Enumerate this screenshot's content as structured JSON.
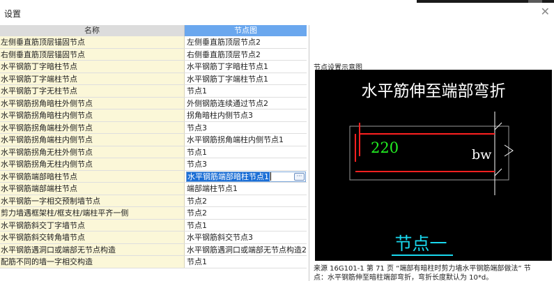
{
  "dialog": {
    "title": "设置",
    "close_icon": "close-icon"
  },
  "table": {
    "headers": [
      "名称",
      "节点图"
    ],
    "rows": [
      [
        "左侧垂直筋顶层锚固节点",
        "左侧垂直筋顶层节点2"
      ],
      [
        "右侧垂直筋顶层锚固节点",
        "右侧垂直筋顶层节点2"
      ],
      [
        "水平钢筋丁字暗柱节点",
        "水平钢筋丁字暗柱节点1"
      ],
      [
        "水平钢筋丁字端柱节点",
        "水平钢筋丁字端柱节点1"
      ],
      [
        "水平钢筋丁字无柱节点",
        "节点1"
      ],
      [
        "水平钢筋拐角暗柱外侧节点",
        "外侧钢筋连续通过节点2"
      ],
      [
        "水平钢筋拐角暗柱内侧节点",
        "拐角暗柱内侧节点3"
      ],
      [
        "水平钢筋拐角端柱外侧节点",
        "节点3"
      ],
      [
        "水平钢筋拐角端柱内侧节点",
        "水平钢筋拐角端柱内侧节点1"
      ],
      [
        "水平钢筋拐角无柱外侧节点",
        "节点1"
      ],
      [
        "水平钢筋拐角无柱内侧节点",
        "节点3"
      ],
      [
        "水平钢筋端部暗柱节点",
        "水平钢筋端部暗柱节点1"
      ],
      [
        "水平钢筋端部端柱节点",
        "端部端柱节点1"
      ],
      [
        "水平钢筋一字相交预制墙节点",
        "节点2"
      ],
      [
        "剪力墙遇框架柱/框支柱/端柱平齐一侧",
        "节点2"
      ],
      [
        "水平钢筋斜交丁字墙节点",
        "节点1"
      ],
      [
        "水平钢筋斜交转角墙节点",
        "水平钢筋斜交节点3"
      ],
      [
        "水平钢筋遇洞口或端部无节点构造",
        "水平钢筋遇洞口或端部无节点构造2"
      ],
      [
        "配筋不同的墙一字相交构造",
        "节点1"
      ]
    ],
    "editing_row_index": 11,
    "ellipsis_label": "···"
  },
  "preview": {
    "caption": "节点设置示意图",
    "diagram": {
      "heading": "水平筋伸至端部弯折",
      "dimension": "220",
      "wall_label": "bw",
      "node_label": "节点一"
    },
    "source_line1": "来源 16G101-1 第 71 页 “端部有暗柱时剪力墙水平钢筋端部做法” 节",
    "source_line2": "点：水平钢筋伸至暗柱端部弯折，弯折长度默认为 10*d。"
  },
  "colors": {
    "header_blue": "#6aa7ee",
    "name_cell_bg": "#fbf7d8",
    "rebar_red": "#ff2020",
    "dim_green": "#22ee22",
    "node_cyan": "#19d9ef",
    "selection_blue": "#1c6fd6"
  }
}
